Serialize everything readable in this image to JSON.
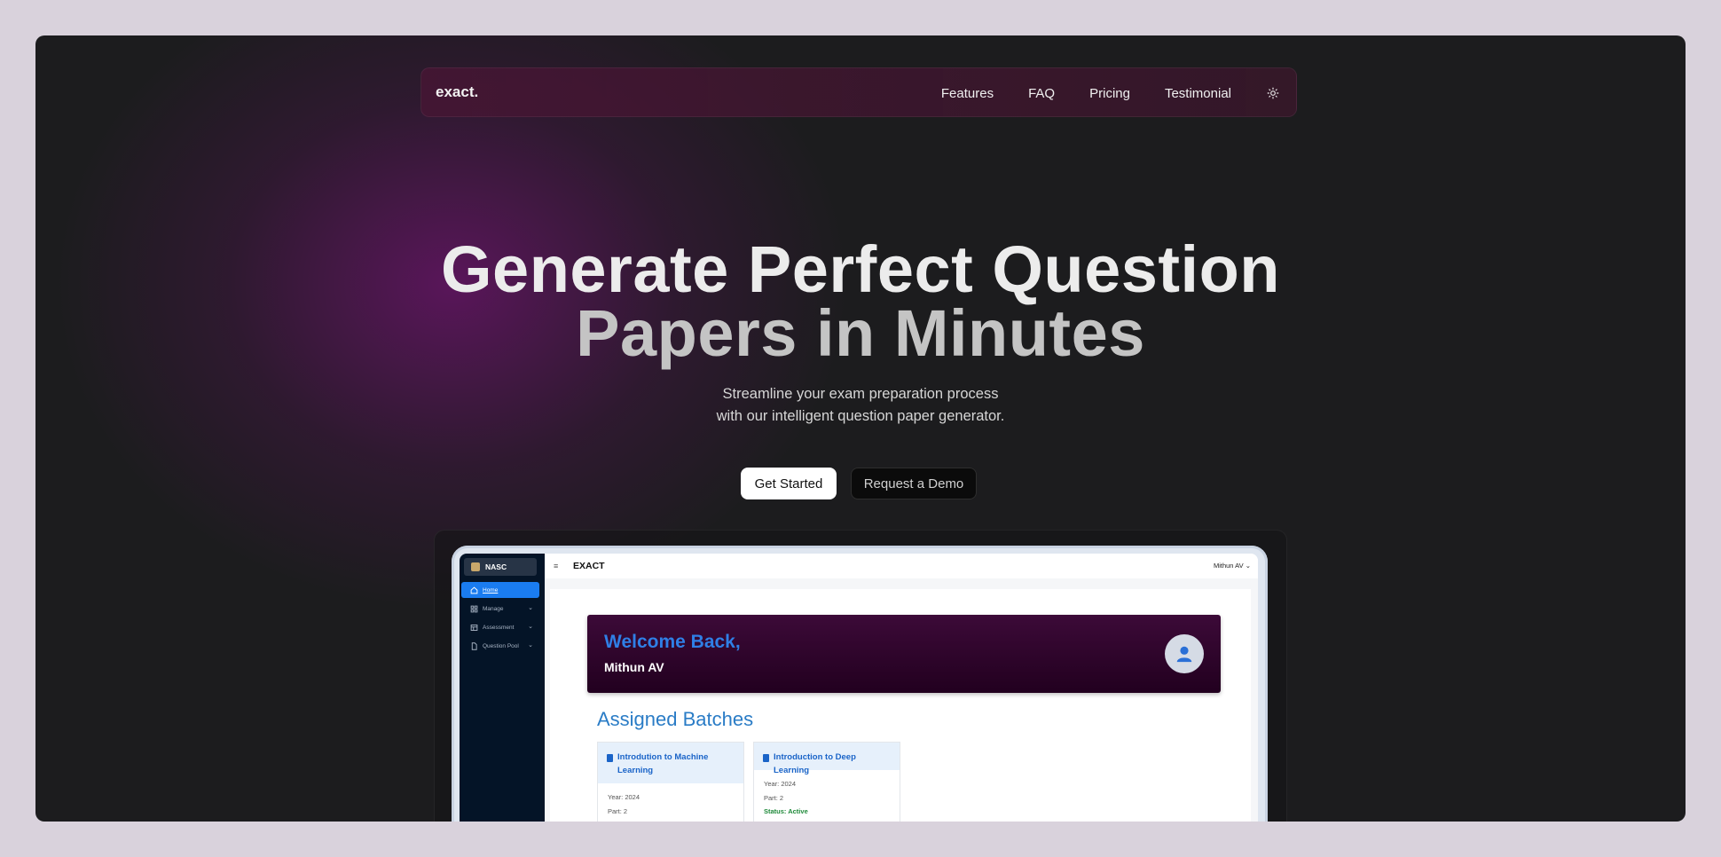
{
  "nav": {
    "logo": "exact.",
    "links": [
      "Features",
      "FAQ",
      "Pricing",
      "Testimonial"
    ],
    "theme_toggle_icon": "sun-icon"
  },
  "hero": {
    "headline_line1": "Generate Perfect Question",
    "headline_line2": "Papers in Minutes",
    "sub_line1": "Streamline your exam preparation process",
    "sub_line2": "with our intelligent question paper generator.",
    "primary_cta": "Get Started",
    "secondary_cta": "Request a Demo"
  },
  "preview": {
    "sidebar": {
      "brand": "NASC",
      "items": [
        {
          "label": "Home",
          "icon": "home-icon",
          "active": true
        },
        {
          "label": "Manage",
          "icon": "grid-icon"
        },
        {
          "label": "Assessment",
          "icon": "table-icon"
        },
        {
          "label": "Question Pool",
          "icon": "document-icon"
        }
      ]
    },
    "topbar": {
      "menu_icon": "menu-icon",
      "title": "EXACT",
      "user": "Mithun AV"
    },
    "welcome": {
      "title": "Welcome Back,",
      "name": "Mithun AV"
    },
    "batches": {
      "title": "Assigned Batches",
      "cards": [
        {
          "title": "Introdution to Machine Learning",
          "year": "Year: 2024",
          "part": "Part: 2"
        },
        {
          "title": "Introduction to Deep Learning",
          "year": "Year: 2024",
          "part": "Part: 2",
          "status": "Status: Active"
        }
      ]
    }
  },
  "colors": {
    "page_bg": "#d9d2dc",
    "frame_bg": "#1c1c1e",
    "glow": "#6e146e",
    "sidebar_bg": "#041427",
    "accent_blue": "#1a7cf0",
    "welcome_bg": "#3c0a38"
  }
}
